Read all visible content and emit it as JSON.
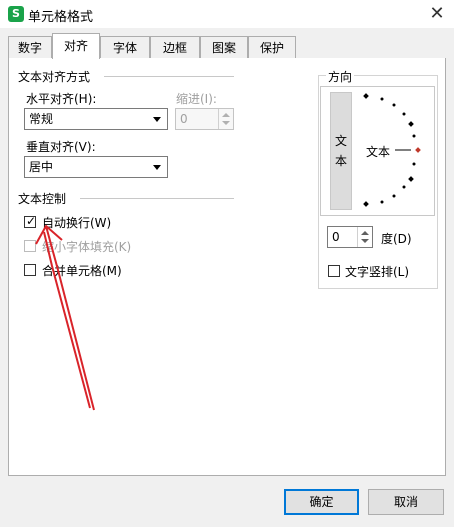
{
  "window": {
    "title": "单元格格式",
    "app_icon_letter": "S",
    "close_glyph": "✕"
  },
  "tabs": [
    {
      "label": "数字"
    },
    {
      "label": "对齐",
      "active": true
    },
    {
      "label": "字体"
    },
    {
      "label": "边框"
    },
    {
      "label": "图案"
    },
    {
      "label": "保护"
    }
  ],
  "alignment": {
    "group_title": "文本对齐方式",
    "horizontal_label": "水平对齐(H):",
    "horizontal_value": "常规",
    "indent_label": "缩进(I):",
    "indent_value": "0",
    "vertical_label": "垂直对齐(V):",
    "vertical_value": "居中"
  },
  "text_control": {
    "group_title": "文本控制",
    "wrap_text": {
      "label": "自动换行(W)",
      "checked": true
    },
    "shrink_to_fit": {
      "label": "缩小字体填充(K)",
      "checked": false,
      "disabled": true
    },
    "merge_cells": {
      "label": "合并单元格(M)",
      "checked": false
    }
  },
  "orientation": {
    "group_title": "方向",
    "vertical_text_button": "文\n本",
    "preview_text": "文本",
    "degrees_value": "0",
    "degrees_label": "度(D)",
    "vertical_stack_label": "文字竖排(L)"
  },
  "footer": {
    "ok_label": "确定",
    "cancel_label": "取消"
  },
  "colors": {
    "accent": "#0078d7",
    "annotation_arrow": "#d9242a",
    "app_icon": "#1aa34a"
  }
}
